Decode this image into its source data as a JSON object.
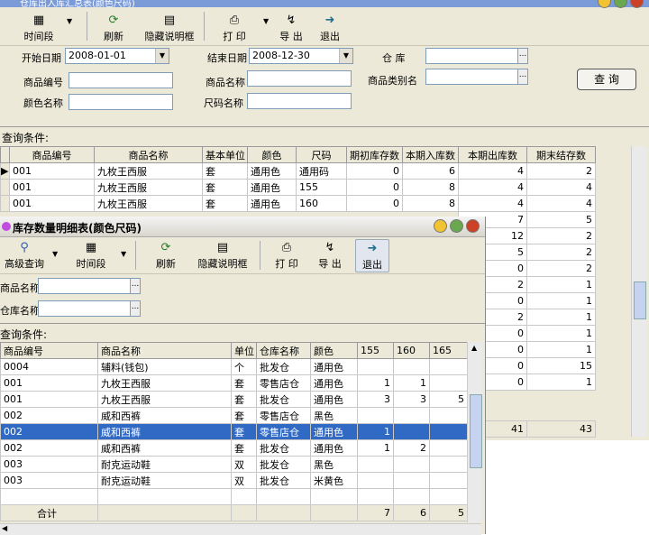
{
  "back_window": {
    "title": "仓库出入库汇总表(颜色尺码)",
    "toolbar": {
      "period": "时间段",
      "refresh": "刷新",
      "hide_desc": "隐藏说明框",
      "print": "打 印",
      "export": "导 出",
      "exit": "退出"
    },
    "filters": {
      "start_label": "开始日期",
      "start_value": "2008-01-01",
      "end_label": "结束日期",
      "end_value": "2008-12-30",
      "warehouse_label": "仓    库",
      "product_code_label": "商品编号",
      "product_name_label": "商品名称",
      "category_label": "商品类别名",
      "color_label": "颜色名称",
      "size_label": "尺码名称"
    },
    "query_button": "查 询",
    "conditions": "查询条件:",
    "table": {
      "headers": [
        "商品编号",
        "商品名称",
        "基本单位",
        "颜色",
        "尺码",
        "期初库存数",
        "本期入库数",
        "本期出库数",
        "期末结存数"
      ],
      "rows": [
        [
          "001",
          "九枚王西服",
          "套",
          "通用色",
          "通用码",
          "0",
          "6",
          "4",
          "2"
        ],
        [
          "001",
          "九枚王西服",
          "套",
          "通用色",
          "155",
          "0",
          "8",
          "4",
          "4"
        ],
        [
          "001",
          "九枚王西服",
          "套",
          "通用色",
          "160",
          "0",
          "8",
          "4",
          "4"
        ]
      ],
      "right_out": [
        "7",
        "12",
        "5",
        "0",
        "2",
        "0",
        "2",
        "0",
        "0",
        "0",
        "0"
      ],
      "right_end": [
        "5",
        "2",
        "2",
        "2",
        "1",
        "1",
        "1",
        "1",
        "1",
        "15",
        "1"
      ],
      "total_out": "41",
      "total_end": "43"
    }
  },
  "front_window": {
    "title": "库存数量明细表(颜色尺码)",
    "toolbar": {
      "advanced": "高级查询",
      "period": "时间段",
      "refresh": "刷新",
      "hide_desc": "隐藏说明框",
      "print": "打 印",
      "export": "导 出",
      "exit": "退出"
    },
    "filters": {
      "product_name_label": "商品名称",
      "warehouse_label": "仓库名称"
    },
    "conditions": "查询条件:",
    "table": {
      "headers": [
        "商品编号",
        "商品名称",
        "单位",
        "仓库名称",
        "颜色",
        "155",
        "160",
        "165"
      ],
      "rows": [
        [
          "0004",
          "辅料(钱包)",
          "个",
          "批发仓",
          "通用色",
          "",
          "",
          ""
        ],
        [
          "001",
          "九枚王西服",
          "套",
          "零售店仓",
          "通用色",
          "1",
          "1",
          ""
        ],
        [
          "001",
          "九枚王西服",
          "套",
          "批发仓",
          "通用色",
          "3",
          "3",
          "5"
        ],
        [
          "002",
          "威和西裤",
          "套",
          "零售店仓",
          "黑色",
          "",
          "",
          ""
        ],
        [
          "002",
          "威和西裤",
          "套",
          "零售店仓",
          "通用色",
          "1",
          "",
          ""
        ],
        [
          "002",
          "威和西裤",
          "套",
          "批发仓",
          "通用色",
          "1",
          "2",
          ""
        ],
        [
          "003",
          "耐克运动鞋",
          "双",
          "批发仓",
          "黑色",
          "",
          "",
          ""
        ],
        [
          "003",
          "耐克运动鞋",
          "双",
          "批发仓",
          "米黄色",
          "",
          "",
          ""
        ]
      ],
      "selected_row": 4,
      "total_label": "合计",
      "totals": [
        "7",
        "6",
        "5"
      ]
    }
  }
}
